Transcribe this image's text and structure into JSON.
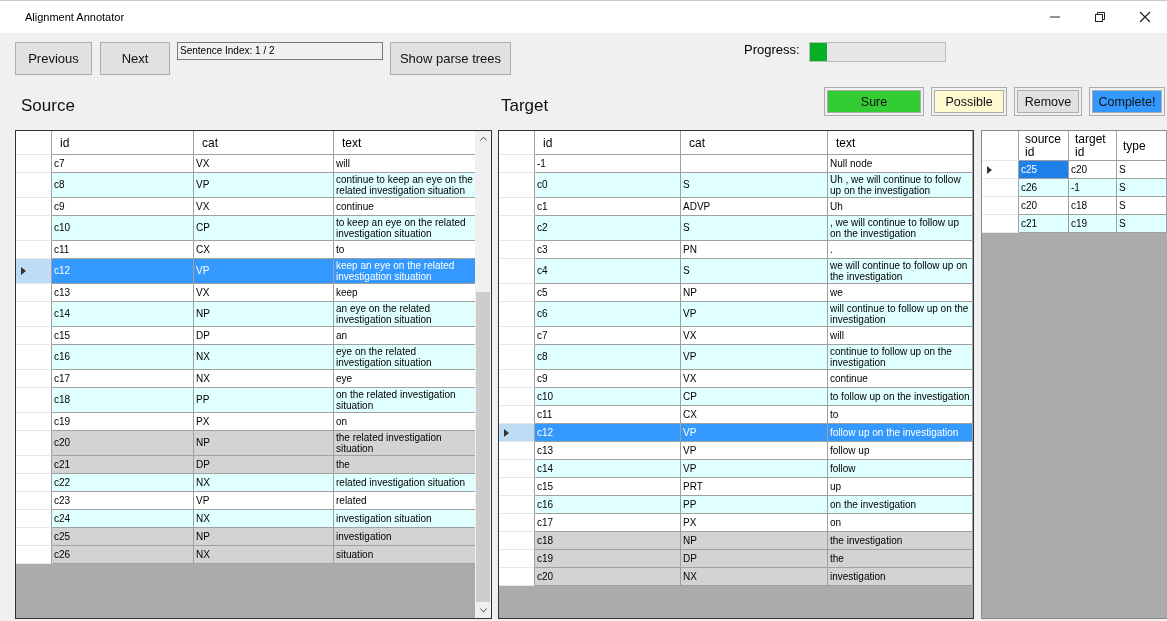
{
  "window": {
    "title": "Alignment Annotator"
  },
  "toolbar": {
    "buttons": [
      "Previous",
      "Next"
    ],
    "sentence_index": "Sentence Index: 1 / 2",
    "parse_button": "Show parse trees"
  },
  "progress": {
    "label": "Progress:",
    "level": 0.13
  },
  "actions": [
    {
      "label": "Sure",
      "color": "#33cc33"
    },
    {
      "label": "Possible",
      "color": "#fffad0"
    },
    {
      "label": "Remove",
      "color": "#e1e1e1"
    },
    {
      "label": "Complete!",
      "color": "#3399ff"
    }
  ],
  "source": {
    "title": "Source",
    "columns": [
      "id",
      "cat",
      "text"
    ],
    "rows": [
      {
        "id": "c7",
        "cat": "VX",
        "text": "will",
        "aligned": false,
        "selected": false
      },
      {
        "id": "c8",
        "cat": "VP",
        "text": "continue to keep an eye on the related investigation situation",
        "aligned": false,
        "selected": false
      },
      {
        "id": "c9",
        "cat": "VX",
        "text": "continue",
        "aligned": false,
        "selected": false
      },
      {
        "id": "c10",
        "cat": "CP",
        "text": "to keep an eye on the related investigation situation",
        "aligned": false,
        "selected": false
      },
      {
        "id": "c11",
        "cat": "CX",
        "text": "to",
        "aligned": false,
        "selected": false
      },
      {
        "id": "c12",
        "cat": "VP",
        "text": "keep an eye on the related investigation situation",
        "aligned": false,
        "selected": true
      },
      {
        "id": "c13",
        "cat": "VX",
        "text": "keep",
        "aligned": false,
        "selected": false
      },
      {
        "id": "c14",
        "cat": "NP",
        "text": "an eye on the related investigation situation",
        "aligned": false,
        "selected": false
      },
      {
        "id": "c15",
        "cat": "DP",
        "text": "an",
        "aligned": false,
        "selected": false
      },
      {
        "id": "c16",
        "cat": "NX",
        "text": "eye on the related investigation situation",
        "aligned": false,
        "selected": false
      },
      {
        "id": "c17",
        "cat": "NX",
        "text": "eye",
        "aligned": false,
        "selected": false
      },
      {
        "id": "c18",
        "cat": "PP",
        "text": "on the related investigation situation",
        "aligned": false,
        "selected": false
      },
      {
        "id": "c19",
        "cat": "PX",
        "text": "on",
        "aligned": false,
        "selected": false
      },
      {
        "id": "c20",
        "cat": "NP",
        "text": "the related investigation situation",
        "aligned": true,
        "selected": false
      },
      {
        "id": "c21",
        "cat": "DP",
        "text": "the",
        "aligned": true,
        "selected": false
      },
      {
        "id": "c22",
        "cat": "NX",
        "text": "related investigation situation",
        "aligned": false,
        "selected": false
      },
      {
        "id": "c23",
        "cat": "VP",
        "text": "related",
        "aligned": false,
        "selected": false
      },
      {
        "id": "c24",
        "cat": "NX",
        "text": "investigation situation",
        "aligned": false,
        "selected": false
      },
      {
        "id": "c25",
        "cat": "NP",
        "text": "investigation",
        "aligned": true,
        "selected": false
      },
      {
        "id": "c26",
        "cat": "NX",
        "text": "situation",
        "aligned": true,
        "selected": false
      }
    ]
  },
  "target": {
    "title": "Target",
    "columns": [
      "id",
      "cat",
      "text"
    ],
    "rows": [
      {
        "id": "-1",
        "text": "Null node",
        "aligned": false,
        "selected": false
      },
      {
        "id": "c0",
        "cat": "S",
        "text": "Uh , we will continue to follow up on the investigation",
        "aligned": false,
        "selected": false
      },
      {
        "id": "c1",
        "cat": "ADVP",
        "text": "Uh",
        "aligned": false,
        "selected": false
      },
      {
        "id": "c2",
        "cat": "S",
        "text": ", we will continue to follow up on the investigation",
        "aligned": false,
        "selected": false
      },
      {
        "id": "c3",
        "cat": "PN",
        "text": ".",
        "aligned": false,
        "selected": false
      },
      {
        "id": "c4",
        "cat": "S",
        "text": "we will continue to follow up on the investigation",
        "aligned": false,
        "selected": false
      },
      {
        "id": "c5",
        "cat": "NP",
        "text": "we",
        "aligned": false,
        "selected": false
      },
      {
        "id": "c6",
        "cat": "VP",
        "text": "will continue to follow up on the investigation",
        "aligned": false,
        "selected": false
      },
      {
        "id": "c7",
        "cat": "VX",
        "text": "will",
        "aligned": false,
        "selected": false
      },
      {
        "id": "c8",
        "cat": "VP",
        "text": "continue to follow up on the investigation",
        "aligned": false,
        "selected": false
      },
      {
        "id": "c9",
        "cat": "VX",
        "text": "continue",
        "aligned": false,
        "selected": false
      },
      {
        "id": "c10",
        "cat": "CP",
        "text": "to follow up on the investigation",
        "aligned": false,
        "selected": false
      },
      {
        "id": "c11",
        "cat": "CX",
        "text": "to",
        "aligned": false,
        "selected": false
      },
      {
        "id": "c12",
        "cat": "VP",
        "text": "follow up on the investigation",
        "aligned": false,
        "selected": true
      },
      {
        "id": "c13",
        "cat": "VP",
        "text": "follow up",
        "aligned": false,
        "selected": false
      },
      {
        "id": "c14",
        "cat": "VP",
        "text": "follow",
        "aligned": false,
        "selected": false
      },
      {
        "id": "c15",
        "cat": "PRT",
        "text": "up",
        "aligned": false,
        "selected": false
      },
      {
        "id": "c16",
        "cat": "PP",
        "text": "on the investigation",
        "aligned": false,
        "selected": false
      },
      {
        "id": "c17",
        "cat": "PX",
        "text": "on",
        "aligned": false,
        "selected": false
      },
      {
        "id": "c18",
        "cat": "NP",
        "text": "the investigation",
        "aligned": true,
        "selected": false
      },
      {
        "id": "c19",
        "cat": "DP",
        "text": "the",
        "aligned": true,
        "selected": false
      },
      {
        "id": "c20",
        "cat": "NX",
        "text": "investigation",
        "aligned": true,
        "selected": false
      }
    ]
  },
  "alignments": {
    "columns": [
      "source id",
      "target id",
      "type"
    ],
    "rows": [
      {
        "source_id": "c25",
        "target_id": "c20",
        "type": "S",
        "selected": true
      },
      {
        "source_id": "c26",
        "target_id": "-1",
        "type": "S",
        "selected": false
      },
      {
        "source_id": "c20",
        "target_id": "c18",
        "type": "S",
        "selected": false
      },
      {
        "source_id": "c21",
        "target_id": "c19",
        "type": "S",
        "selected": false
      }
    ]
  }
}
